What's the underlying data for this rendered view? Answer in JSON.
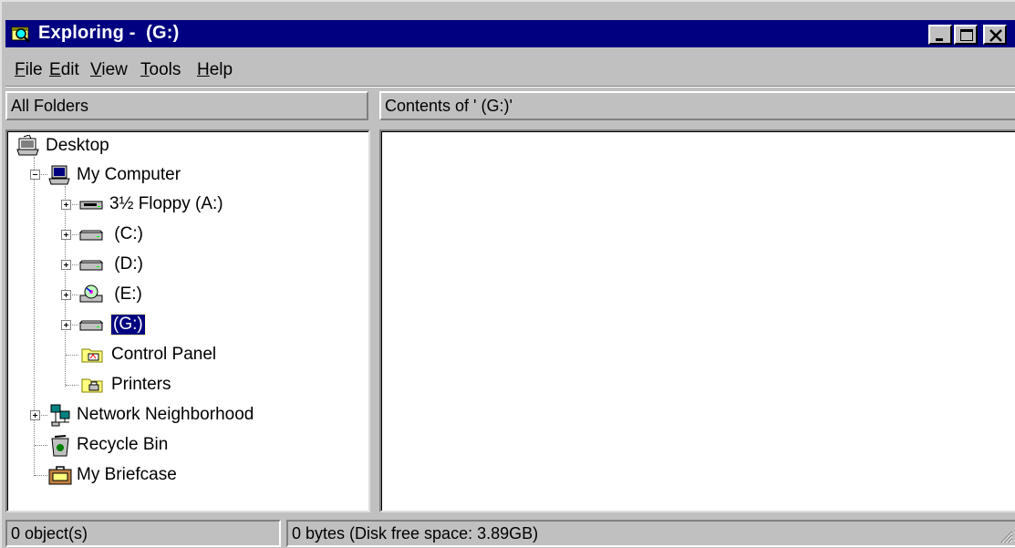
{
  "window": {
    "title": "Exploring -  (G:)",
    "title_icon": "explorer-magnifier-icon",
    "controls": [
      "minimize-icon",
      "maximize-icon",
      "close-icon"
    ]
  },
  "menu": {
    "file": {
      "accel": "F",
      "rest": "ile"
    },
    "edit": {
      "accel": "E",
      "rest": "dit"
    },
    "view": {
      "accel": "V",
      "rest": "iew"
    },
    "tools": {
      "accel": "T",
      "rest": "ools"
    },
    "help": {
      "accel": "H",
      "rest": "elp"
    }
  },
  "left_pane": {
    "header": "All Folders",
    "tree": [
      {
        "label": "Desktop",
        "icon": "desktop-icon"
      },
      {
        "label": "My Computer",
        "icon": "computer-icon",
        "expanded": true
      },
      {
        "label": "3½ Floppy (A:)",
        "icon": "floppy-drive-icon"
      },
      {
        "label": " (C:)",
        "icon": "hard-drive-icon"
      },
      {
        "label": " (D:)",
        "icon": "hard-drive-icon"
      },
      {
        "label": " (E:)",
        "icon": "cd-drive-icon"
      },
      {
        "label": "(G:)",
        "icon": "hard-drive-icon",
        "selected": true
      },
      {
        "label": "Control Panel",
        "icon": "control-panel-folder-icon"
      },
      {
        "label": "Printers",
        "icon": "printers-folder-icon"
      },
      {
        "label": "Network Neighborhood",
        "icon": "network-icon"
      },
      {
        "label": "Recycle Bin",
        "icon": "recycle-bin-icon"
      },
      {
        "label": "My Briefcase",
        "icon": "briefcase-icon"
      }
    ]
  },
  "right_pane": {
    "header": "Contents of ' (G:)'"
  },
  "status": {
    "objects": "0 object(s)",
    "disk": "0 bytes (Disk free space: 3.89GB)"
  },
  "colors": {
    "titlebar": "#000080",
    "face": "#c0c0c0",
    "selection": "#000080"
  }
}
